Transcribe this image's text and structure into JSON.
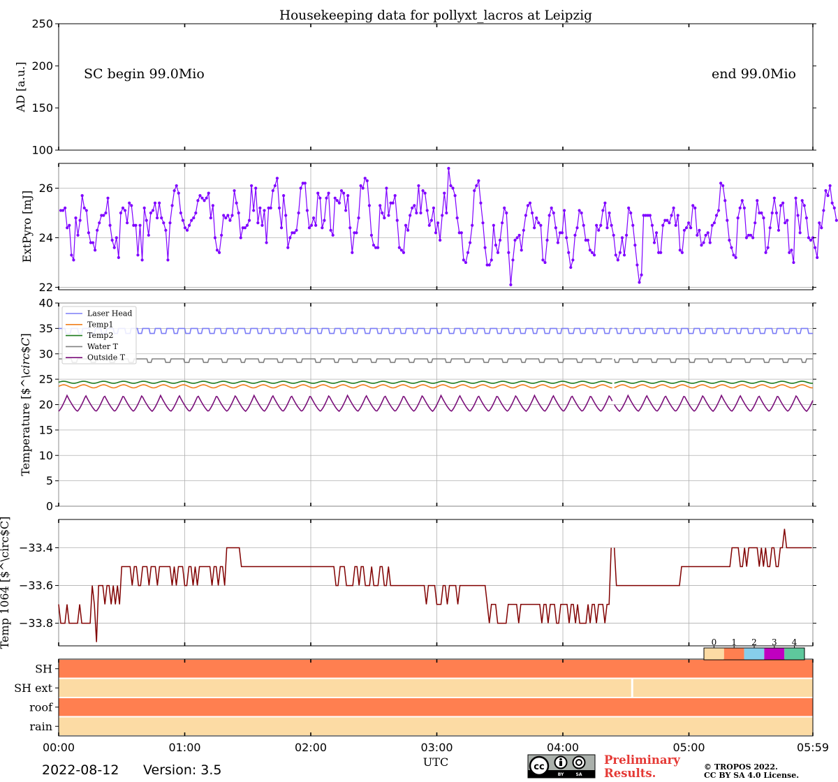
{
  "title": "Housekeeping data for pollyxt_lacros at Leipzig",
  "footer": {
    "date": "2022-08-12",
    "version": "Version: 3.5",
    "preliminary_line1": "Preliminary",
    "preliminary_line2": "Results.",
    "copyright_line1": "© TROPOS 2022.",
    "copyright_line2": "CC BY SA 4.0 License.",
    "cc_by": "BY",
    "cc_sa": "SA"
  },
  "x_axis": {
    "label": "UTC",
    "ticks": [
      "00:00",
      "01:00",
      "02:00",
      "03:00",
      "04:00",
      "05:00",
      "05:59"
    ],
    "tick_minutes": [
      0,
      60,
      120,
      180,
      240,
      300,
      359
    ],
    "range_minutes": [
      0,
      359
    ]
  },
  "chart_data": [
    {
      "id": "ad",
      "type": "line",
      "ylabel": "AD [a.u.]",
      "ylim": [
        100,
        250
      ],
      "yticks": [
        "100",
        "150",
        "200",
        "250"
      ],
      "ytick_values": [
        100,
        150,
        200,
        250
      ],
      "grid": false,
      "series": [],
      "annotations": {
        "left": "SC begin 99.0Mio",
        "right": "end 99.0Mio"
      }
    },
    {
      "id": "pyro",
      "type": "line",
      "ylabel": "ExtPyro [mJ]",
      "ylim": [
        21.9,
        27.0
      ],
      "yticks": [
        "22",
        "24",
        "26"
      ],
      "ytick_values": [
        22,
        24,
        26
      ],
      "grid": true,
      "color": "#7f00ff",
      "markers": true,
      "x_start_min": 1,
      "x_step_min": 1.02,
      "values": [
        25.1,
        25.1,
        25.2,
        24.4,
        24.5,
        23.3,
        23.1,
        24.8,
        24.1,
        24.7,
        25.7,
        25.2,
        25.1,
        24.2,
        23.8,
        23.8,
        23.5,
        24.3,
        24.6,
        24.9,
        24.9,
        25.0,
        25.6,
        24.5,
        23.9,
        23.6,
        24.0,
        23.2,
        25.0,
        25.2,
        25.1,
        24.6,
        25.4,
        25.3,
        24.5,
        24.5,
        23.3,
        24.5,
        23.1,
        25.2,
        24.7,
        24.1,
        25.0,
        25.1,
        25.4,
        24.8,
        25.4,
        24.8,
        24.6,
        24.3,
        23.1,
        24.6,
        25.3,
        25.9,
        26.1,
        25.8,
        25.0,
        24.7,
        24.4,
        24.3,
        24.5,
        24.7,
        24.8,
        25.0,
        25.5,
        25.7,
        25.6,
        25.5,
        25.6,
        25.8,
        24.8,
        25.3,
        24.0,
        23.5,
        23.4,
        24.1,
        24.9,
        24.8,
        24.9,
        24.7,
        24.9,
        25.9,
        25.4,
        25.0,
        24.0,
        24.4,
        24.4,
        24.5,
        24.7,
        26.1,
        25.1,
        26.0,
        24.6,
        25.2,
        24.5,
        25.1,
        23.8,
        25.2,
        25.2,
        25.9,
        26.1,
        26.4,
        25.2,
        24.4,
        25.7,
        24.9,
        23.6,
        24.0,
        24.2,
        24.2,
        24.3,
        25.0,
        26.0,
        26.2,
        26.2,
        25.1,
        24.4,
        24.5,
        24.8,
        24.5,
        25.8,
        25.6,
        24.4,
        24.7,
        25.6,
        25.8,
        24.3,
        24.1,
        25.6,
        25.5,
        25.4,
        25.9,
        25.8,
        25.1,
        25.7,
        24.4,
        23.4,
        24.2,
        24.2,
        24.8,
        26.1,
        26.0,
        26.4,
        26.3,
        25.3,
        24.1,
        23.7,
        23.6,
        23.6,
        25.3,
        25.0,
        24.8,
        26.0,
        24.9,
        25.4,
        25.4,
        25.7,
        24.7,
        23.6,
        23.5,
        23.4,
        24.5,
        24.3,
        24.9,
        25.2,
        25.3,
        25.0,
        26.1,
        25.0,
        25.9,
        25.8,
        25.1,
        24.5,
        24.7,
        25.2,
        24.2,
        24.6,
        23.9,
        24.9,
        25.8,
        25.0,
        26.8,
        26.1,
        26.0,
        25.7,
        24.8,
        24.2,
        24.2,
        23.1,
        23.0,
        23.4,
        23.8,
        24.5,
        25.9,
        26.1,
        26.3,
        25.4,
        24.6,
        23.6,
        22.9,
        22.9,
        23.1,
        24.5,
        23.7,
        23.4,
        23.9,
        24.6,
        25.2,
        25.0,
        23.4,
        22.1,
        23.1,
        23.9,
        24.0,
        24.1,
        23.5,
        24.3,
        24.9,
        25.3,
        25.4,
        25.0,
        24.4,
        24.8,
        24.6,
        24.5,
        23.1,
        23.0,
        23.9,
        24.9,
        25.2,
        25.0,
        24.4,
        23.8,
        24.2,
        24.2,
        25.1,
        24.0,
        23.4,
        22.8,
        23.1,
        24.1,
        24.4,
        25.1,
        25.0,
        24.5,
        23.9,
        23.9,
        23.5,
        23.4,
        23.3,
        24.5,
        24.3,
        24.5,
        25.1,
        25.4,
        24.4,
        25.0,
        24.5,
        24.1,
        23.3,
        23.1,
        23.4,
        24.0,
        23.3,
        24.1,
        25.2,
        25.0,
        24.5,
        23.7,
        22.9,
        22.2,
        22.5,
        24.9,
        24.9,
        24.9,
        24.9,
        24.5,
        23.8,
        24.2,
        23.4,
        23.4,
        24.5,
        24.7,
        24.7,
        24.6,
        24.9,
        25.2,
        24.5,
        24.9,
        23.5,
        23.4,
        24.3,
        24.4,
        24.6,
        24.4,
        25.3,
        25.2,
        24.1,
        24.3,
        23.7,
        23.8,
        24.1,
        24.2,
        23.8,
        24.5,
        24.6,
        24.9,
        25.1,
        26.2,
        26.1,
        25.5,
        24.7,
        23.9,
        23.6,
        23.3,
        23.2,
        24.8,
        25.2,
        25.5,
        25.2,
        24.0,
        24.1,
        24.1,
        24.0,
        24.6,
        25.5,
        25.0,
        25.0,
        24.8,
        23.4,
        23.6,
        24.4,
        25.0,
        25.6,
        25.0,
        24.3,
        25.3,
        25.4,
        24.6,
        24.7,
        23.4,
        23.5,
        23.0,
        25.6,
        24.9,
        24.2,
        25.5,
        25.3,
        24.8,
        24.0,
        23.9,
        24.0,
        23.6,
        23.2,
        24.6,
        24.4,
        25.1,
        25.9,
        25.7,
        26.1,
        25.4,
        25.2,
        24.7
      ]
    },
    {
      "id": "temperature",
      "type": "line",
      "ylabel": "Temperature [$^\\circ$C]",
      "ylim": [
        0,
        40
      ],
      "yticks": [
        "0",
        "5",
        "10",
        "15",
        "20",
        "25",
        "30",
        "35",
        "40"
      ],
      "ytick_values": [
        0,
        5,
        10,
        15,
        20,
        25,
        30,
        35,
        40
      ],
      "grid": true,
      "legend": "upper-left",
      "gap_minutes": [
        263.5,
        264.5
      ],
      "series": [
        {
          "name": "Laser Head",
          "color": "#7b7df6",
          "shape": "square",
          "base": 34.0,
          "peak": 35.0,
          "period_min": 5.7,
          "peak_fraction": 0.58,
          "gap_break_min": 105
        },
        {
          "name": "Temp1",
          "color": "#f07f1c",
          "shape": "sine",
          "mean": 23.6,
          "amplitude": 0.3,
          "period_min": 9.5
        },
        {
          "name": "Temp2",
          "color": "#1c7a1c",
          "shape": "sine",
          "mean": 24.4,
          "amplitude": 0.2,
          "period_min": 9.5
        },
        {
          "name": "Water T",
          "color": "#808080",
          "shape": "square",
          "base": 28.3,
          "peak": 29.0,
          "period_min": 8.9,
          "peak_fraction": 0.72
        },
        {
          "name": "Outside T",
          "color": "#7a0f7a",
          "shape": "sawtooth",
          "min": 18.7,
          "max": 21.8,
          "period_min": 8.9
        }
      ]
    },
    {
      "id": "temp1064",
      "type": "line",
      "ylabel": "Temp 1064 [$^\\circ$C]",
      "ylim": [
        -33.92,
        -33.25
      ],
      "yticks": [
        "−33.8",
        "−33.6",
        "−33.4"
      ],
      "ytick_values": [
        -33.8,
        -33.6,
        -33.4
      ],
      "grid": true,
      "color": "#800000",
      "gap_minutes": [
        263.5,
        264.5
      ],
      "levels": [
        -33.8,
        -33.7,
        -33.6,
        -33.5,
        -33.4,
        -33.3
      ],
      "segments": [
        {
          "x": [
            0,
            17
          ],
          "base": -33.8,
          "alt": -33.7
        },
        {
          "x": [
            17,
            30
          ],
          "base": -33.6,
          "alt": -33.7
        },
        {
          "x": [
            30,
            60
          ],
          "base": -33.5,
          "alt": -33.6
        },
        {
          "x": [
            60,
            62
          ],
          "base": -33.6,
          "alt": -33.6
        },
        {
          "x": [
            62,
            80
          ],
          "base": -33.5,
          "alt": -33.6
        },
        {
          "x": [
            80,
            87
          ],
          "base": -33.4,
          "alt": -33.4
        },
        {
          "x": [
            87,
            108
          ],
          "base": -33.5,
          "alt": -33.5
        },
        {
          "x": [
            108,
            132
          ],
          "base": -33.5,
          "alt": -33.5
        },
        {
          "x": [
            132,
            158
          ],
          "base": -33.6,
          "alt": -33.5
        },
        {
          "x": [
            158,
            175
          ],
          "base": -33.6,
          "alt": -33.6
        },
        {
          "x": [
            175,
            205
          ],
          "base": -33.6,
          "alt": -33.7
        },
        {
          "x": [
            205,
            263
          ],
          "base": -33.7,
          "alt": -33.8
        },
        {
          "x": [
            265,
            280
          ],
          "base": -33.6,
          "alt": -33.6
        },
        {
          "x": [
            280,
            296
          ],
          "base": -33.6,
          "alt": -33.6
        },
        {
          "x": [
            296,
            320
          ],
          "base": -33.5,
          "alt": -33.5
        },
        {
          "x": [
            320,
            345
          ],
          "base": -33.4,
          "alt": -33.5
        },
        {
          "x": [
            345,
            359
          ],
          "base": -33.4,
          "alt": -33.3
        }
      ],
      "spikes": [
        {
          "x": 18,
          "value": -33.9
        },
        {
          "x": 16,
          "value": -33.6
        },
        {
          "x": 320,
          "value": -33.4
        },
        {
          "x": 357,
          "value": -33.3
        }
      ]
    },
    {
      "id": "status",
      "type": "heatmap",
      "rows": [
        "SH",
        "SH ext",
        "roof",
        "rain"
      ],
      "row_values": [
        1,
        0,
        1,
        0
      ],
      "gaps": [
        {
          "row": "SH ext",
          "minute": 273
        }
      ],
      "colorbar": {
        "ticks": [
          "0",
          "1",
          "2",
          "3",
          "4"
        ],
        "colors": [
          "#fcdba4",
          "#ff7f50",
          "#87ceeb",
          "#c000c0",
          "#5ec89c"
        ]
      }
    }
  ]
}
